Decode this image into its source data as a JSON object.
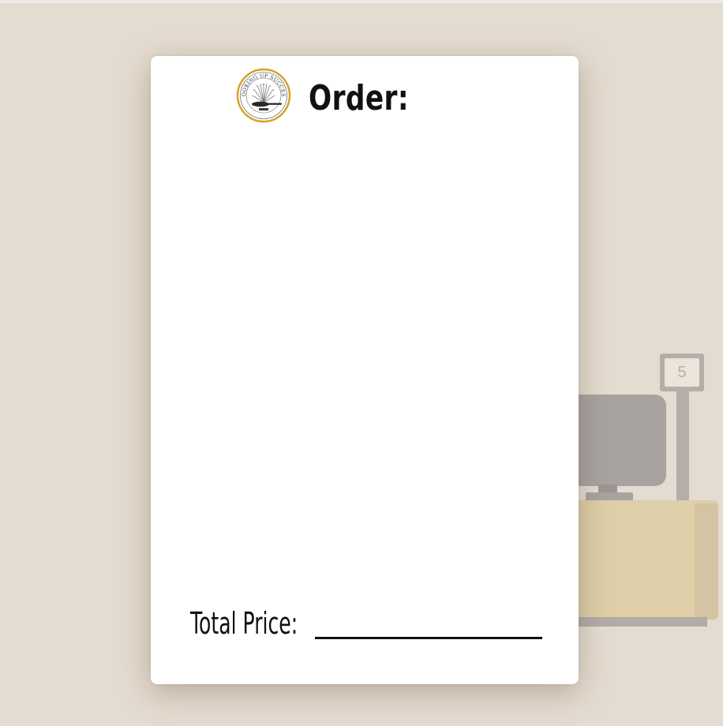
{
  "ticket": {
    "title": "Order:",
    "total_label": "Total Price:",
    "total_value": ""
  },
  "logo": {
    "ring_text": "COOKING UP SUCCESS",
    "icon": "frying-pan-icon"
  },
  "background": {
    "table_number": "5"
  },
  "colors": {
    "backdrop": "#e5dcd1",
    "ticket": "#ffffff",
    "logo_ring": "#d4a227",
    "counter": "#decfa8",
    "register": "#a8a3a0"
  }
}
